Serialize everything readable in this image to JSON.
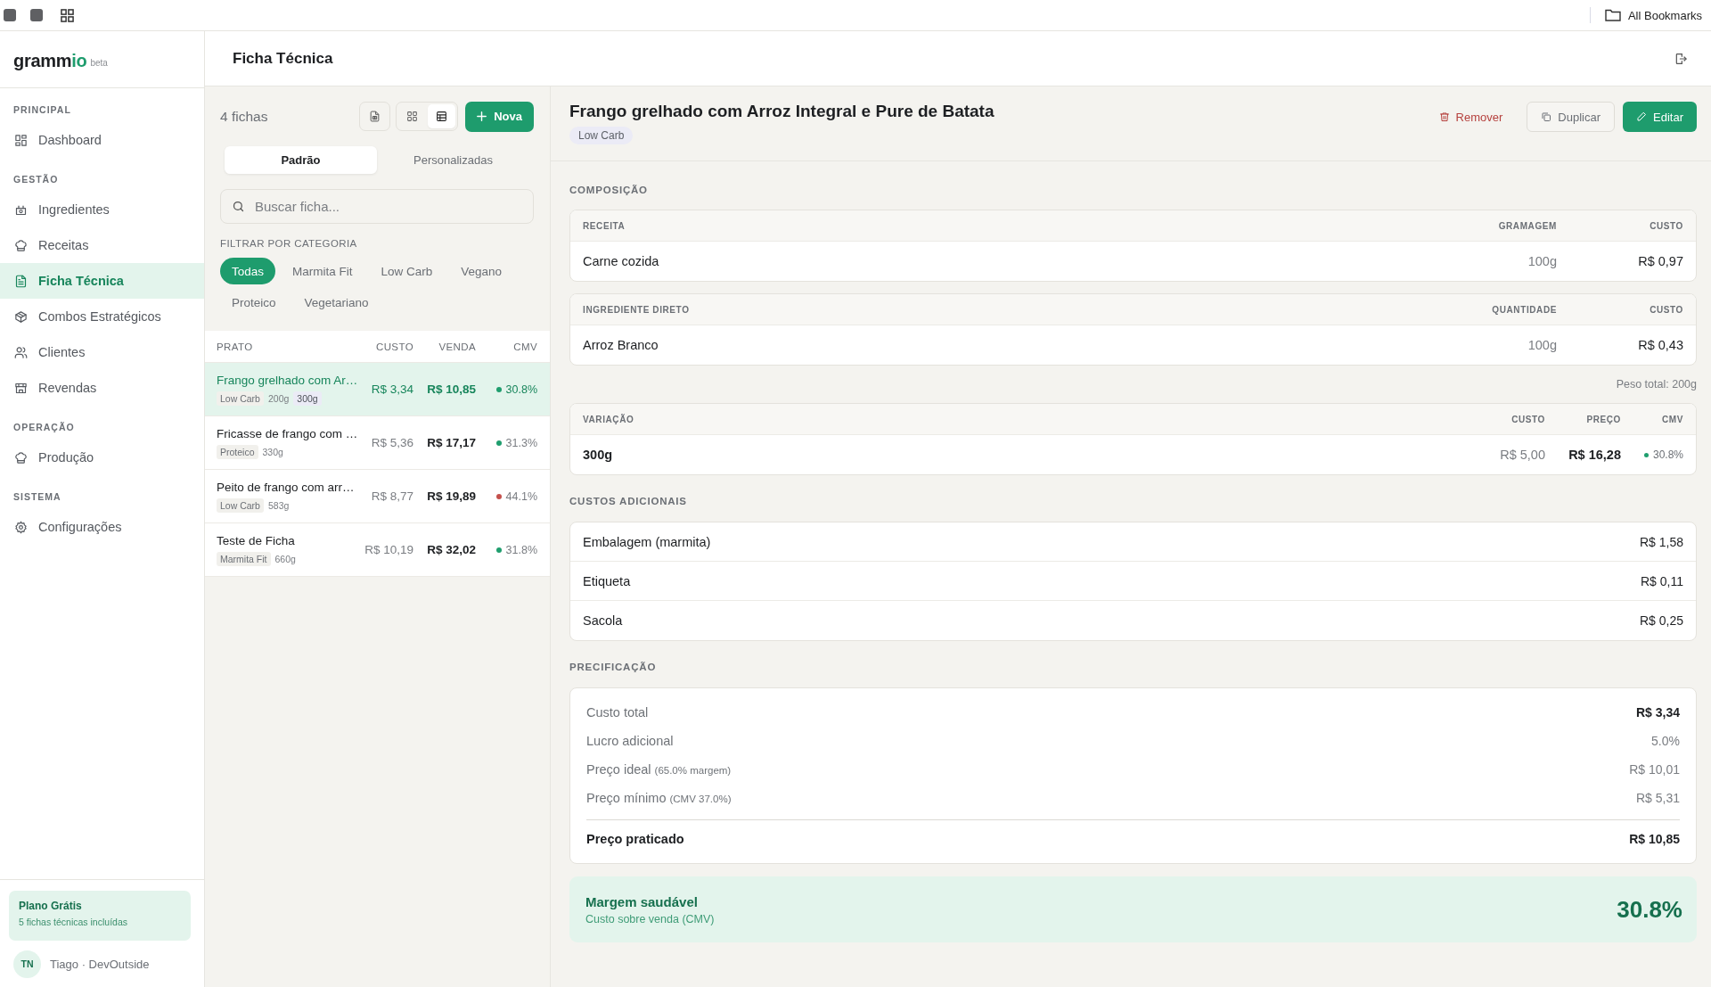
{
  "browser_bar": {
    "bookmarks": "All Bookmarks"
  },
  "sidebar": {
    "logo": {
      "prefix": "gramm",
      "accent": "io",
      "badge": "beta"
    },
    "sections": [
      {
        "label": "PRINCIPAL",
        "items": [
          {
            "label": "Dashboard",
            "selected": false
          }
        ]
      },
      {
        "label": "GESTÃO",
        "items": [
          {
            "label": "Ingredientes",
            "selected": false
          },
          {
            "label": "Receitas",
            "selected": false
          },
          {
            "label": "Ficha Técnica",
            "selected": true
          },
          {
            "label": "Combos Estratégicos",
            "selected": false
          },
          {
            "label": "Clientes",
            "selected": false
          },
          {
            "label": "Revendas",
            "selected": false
          }
        ]
      },
      {
        "label": "OPERAÇÃO",
        "items": [
          {
            "label": "Produção",
            "selected": false
          }
        ]
      },
      {
        "label": "SISTEMA",
        "items": [
          {
            "label": "Configurações",
            "selected": false
          }
        ]
      }
    ],
    "plan": {
      "title": "Plano Grátis",
      "subtitle": "5 fichas técnicas incluídas"
    },
    "user": {
      "initials": "TN",
      "name": "Tiago · DevOutside"
    }
  },
  "header": {
    "title": "Ficha Técnica"
  },
  "list_panel": {
    "count": "4 fichas",
    "view_modes": [
      {
        "selected": false
      },
      {
        "selected": true
      }
    ],
    "new_button": "Nova",
    "tabs": [
      {
        "label": "Padrão",
        "selected": true
      },
      {
        "label": "Personalizadas",
        "selected": false
      }
    ],
    "search": {
      "placeholder": "Buscar ficha..."
    },
    "filter_label": "FILTRAR POR CATEGORIA",
    "categories": [
      {
        "label": "Todas",
        "selected": true
      },
      {
        "label": "Marmita Fit",
        "selected": false
      },
      {
        "label": "Low Carb",
        "selected": false
      },
      {
        "label": "Vegano",
        "selected": false
      },
      {
        "label": "Proteico",
        "selected": false
      },
      {
        "label": "Vegetariano",
        "selected": false
      }
    ],
    "table": {
      "columns": [
        "PRATO",
        "CUSTO",
        "VENDA",
        "CMV"
      ],
      "rows": [
        {
          "name": "Frango grelhado com Ar…",
          "category": "Low Carb",
          "weight": "200g",
          "variations": [
            "300g"
          ],
          "cost": "R$ 3,34",
          "price": "R$ 10,85",
          "cmv": "30.8%",
          "color": "#1f9e6e",
          "selected": true
        },
        {
          "name": "Fricasse de frango com …",
          "category": "Proteico",
          "weight": "330g",
          "cost": "R$ 5,36",
          "price": "R$ 17,17",
          "cmv": "31.3%",
          "color": "#1f9e6e",
          "selected": false
        },
        {
          "name": "Peito de frango com arr…",
          "category": "Low Carb",
          "weight": "583g",
          "cost": "R$ 8,77",
          "price": "R$ 19,89",
          "cmv": "44.1%",
          "color": "#c4504c",
          "selected": false
        },
        {
          "name": "Teste de Ficha",
          "category": "Marmita Fit",
          "weight": "660g",
          "cost": "R$ 10,19",
          "price": "R$ 32,02",
          "cmv": "31.8%",
          "color": "#1f9e6e",
          "selected": false
        }
      ]
    }
  },
  "detail": {
    "title": "Frango grelhado com Arroz Integral e Pure de Batata",
    "tag": "Low Carb",
    "actions": [
      {
        "kind": "remove",
        "label": "Remover"
      },
      {
        "kind": "duplicate",
        "label": "Duplicar"
      },
      {
        "kind": "edit",
        "label": "Editar"
      }
    ],
    "composition": {
      "label": "COMPOSIÇÃO",
      "tables": [
        {
          "columns": [
            "RECEITA",
            "GRAMAGEM",
            "CUSTO"
          ],
          "rows": [
            [
              "Carne cozida",
              "100g",
              "R$ 0,97"
            ]
          ]
        },
        {
          "columns": [
            "INGREDIENTE DIRETO",
            "QUANTIDADE",
            "CUSTO"
          ],
          "rows": [
            [
              "Arroz Branco",
              "100g",
              "R$ 0,43"
            ]
          ]
        }
      ],
      "total_weight": "Peso total: 200g"
    },
    "variations": {
      "columns": [
        "VARIAÇÃO",
        "CUSTO",
        "PREÇO",
        "CMV"
      ],
      "rows": [
        {
          "name": "300g",
          "cost": "R$ 5,00",
          "price": "R$ 16,28",
          "cmv": "30.8%",
          "color": "#1f9e6e"
        }
      ]
    },
    "additional_costs": {
      "label": "CUSTOS ADICIONAIS",
      "items": [
        {
          "name": "Embalagem (marmita)",
          "value": "R$ 1,58"
        },
        {
          "name": "Etiqueta",
          "value": "R$ 0,11"
        },
        {
          "name": "Sacola",
          "value": "R$ 0,25"
        }
      ]
    },
    "pricing": {
      "label": "PRECIFICAÇÃO",
      "rows": [
        {
          "kind": "total",
          "label": "Custo total",
          "value": "R$ 3,34"
        },
        {
          "kind": "item",
          "label": "Lucro adicional",
          "value": "5.0%"
        },
        {
          "kind": "item",
          "label": "Preço ideal",
          "note": "(65.0% margem)",
          "value": "R$ 10,01"
        },
        {
          "kind": "item",
          "label": "Preço mínimo",
          "note": "(CMV 37.0%)",
          "value": "R$ 5,31"
        },
        {
          "kind": "final",
          "label": "Preço praticado",
          "value": "R$ 10,85"
        }
      ]
    },
    "margin": {
      "title": "Margem saudável",
      "subtitle": "Custo sobre venda (CMV)",
      "value": "30.8%"
    }
  }
}
